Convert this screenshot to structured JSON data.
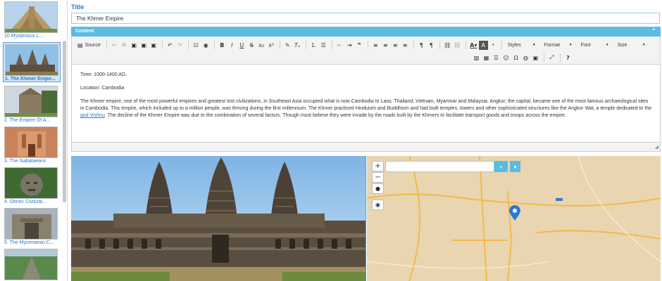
{
  "sidebar": {
    "slides": [
      {
        "caption": "10 Mysterious L...",
        "thumb": "pyramid"
      },
      {
        "caption": "1. The Khmer Empir...",
        "thumb": "temple",
        "active": true
      },
      {
        "caption": "2. The Empire Of A...",
        "thumb": "church"
      },
      {
        "caption": "3. The Nabataeans",
        "thumb": "petra"
      },
      {
        "caption": "4. Olmec Civilizat...",
        "thumb": "olmec"
      },
      {
        "caption": "5. The Mycenaean C...",
        "thumb": "gate"
      },
      {
        "caption": "",
        "thumb": "jungle"
      }
    ]
  },
  "title": {
    "label": "Title",
    "value": "The Khmer Empire"
  },
  "content": {
    "label": "Content"
  },
  "toolbar": {
    "source_label": "Source",
    "styles_label": "Styles",
    "format_label": "Format",
    "font_label": "Font",
    "size_label": "Size"
  },
  "editor": {
    "time": "Time: 1000-1400 AD.",
    "location": "Location: Cambodia",
    "body_part1": "The Khmer empire, one of the most powerful empires and greatest lost civilizations, in Southeast Asia occupied what is now Cambodia to Laos, Thailand, Vietnam, Myanmar and Malaysia. Angkor, the capital, became one of the most famous archaeological sites in Cambodia. This empire, which included up to a million people, was thriving during the first millennium. The Khmer practiced Hinduism and Buddhism and had built temples, towers and other sophisticated structures like the Angkor Wat, a temple dedicated to the ",
    "link_text": "god Vishnu",
    "body_part2": ". The decline of the Khmer Empire was due to the combination of several factors. Though most believe they were invade by the roads built by the Khmers to facilitate transport goods and troops across the empire."
  },
  "map": {
    "search_value": "",
    "icons": {
      "zoom_in": "plus-icon",
      "zoom_out": "minus-icon",
      "layers": "globe-icon",
      "locate": "target-icon",
      "search": "search-icon",
      "pin": "pin-icon"
    }
  },
  "colors": {
    "accent": "#5bbbe1",
    "link": "#2a78c8",
    "active_bg": "#cfe6f7"
  }
}
